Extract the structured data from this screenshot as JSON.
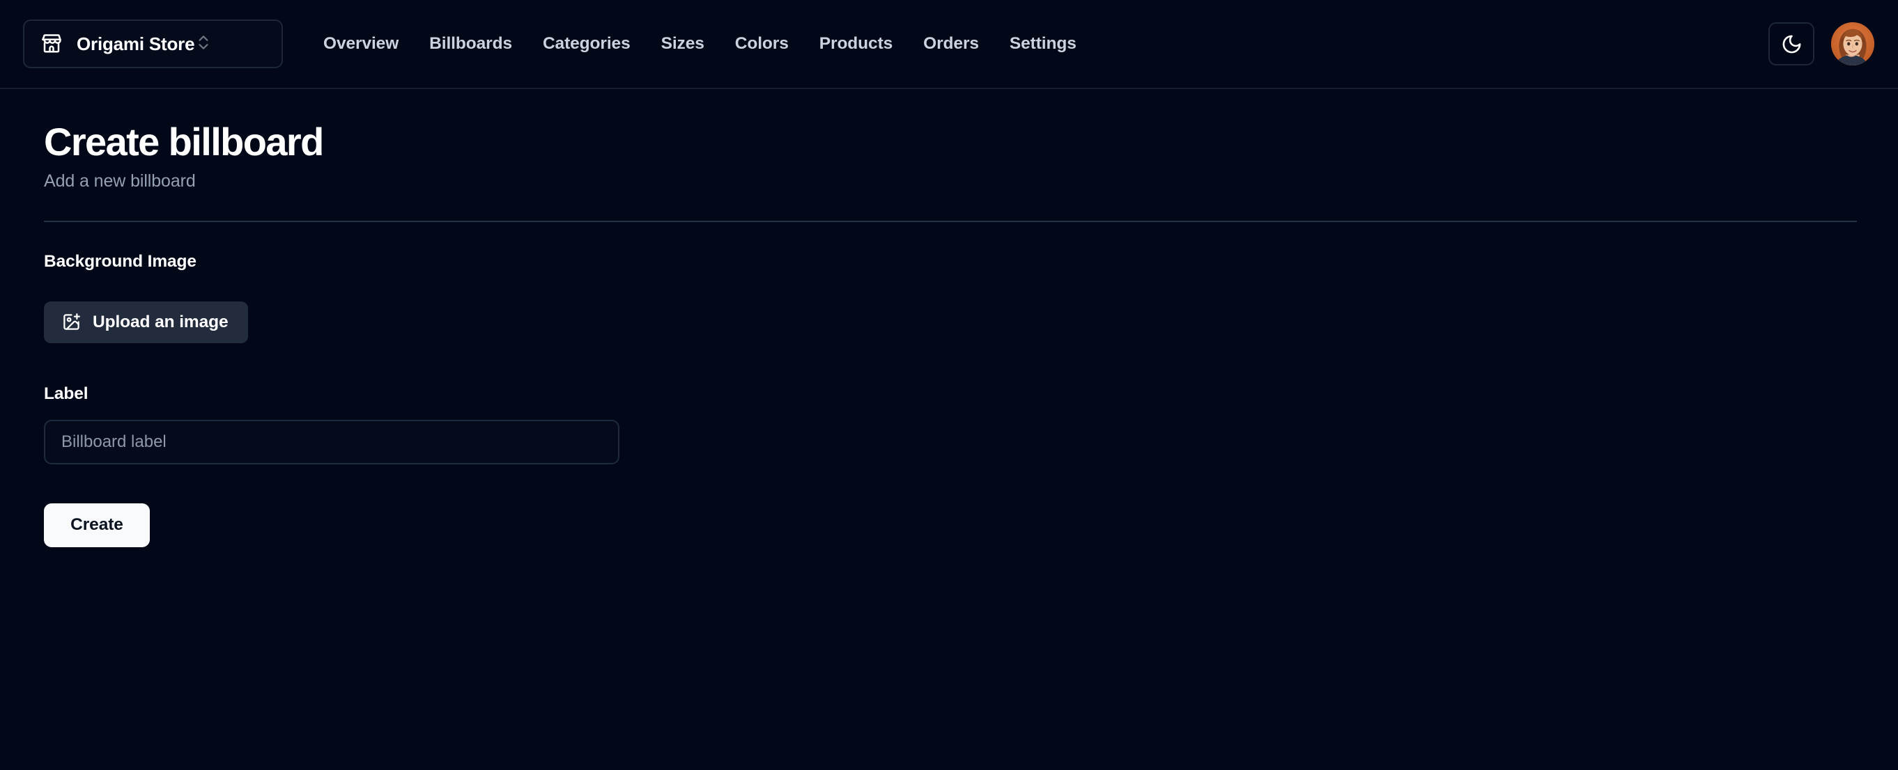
{
  "colors": {
    "background": "#020817",
    "border": "#1d273a",
    "muted_text": "#95a0b3",
    "nav_text": "#ccd3e0",
    "upload_button_bg": "#232c3c",
    "primary_button_bg": "#f8fafc",
    "primary_button_text": "#0b1220",
    "separator": "#243048"
  },
  "header": {
    "store_switcher": {
      "name": "Origami Store",
      "store_icon": "store-icon",
      "chevron_icon": "chevrons-up-down-icon"
    },
    "nav": [
      {
        "label": "Overview"
      },
      {
        "label": "Billboards"
      },
      {
        "label": "Categories"
      },
      {
        "label": "Sizes"
      },
      {
        "label": "Colors"
      },
      {
        "label": "Products"
      },
      {
        "label": "Orders"
      },
      {
        "label": "Settings"
      }
    ],
    "theme_toggle": {
      "icon": "moon-icon"
    },
    "avatar": {
      "icon": "user-avatar"
    }
  },
  "page": {
    "title": "Create billboard",
    "subtitle": "Add a new billboard"
  },
  "form": {
    "background_image": {
      "section_label": "Background Image",
      "upload_button_label": "Upload an image",
      "upload_icon": "image-plus-icon"
    },
    "label_field": {
      "label": "Label",
      "placeholder": "Billboard label",
      "value": ""
    },
    "submit_label": "Create"
  }
}
